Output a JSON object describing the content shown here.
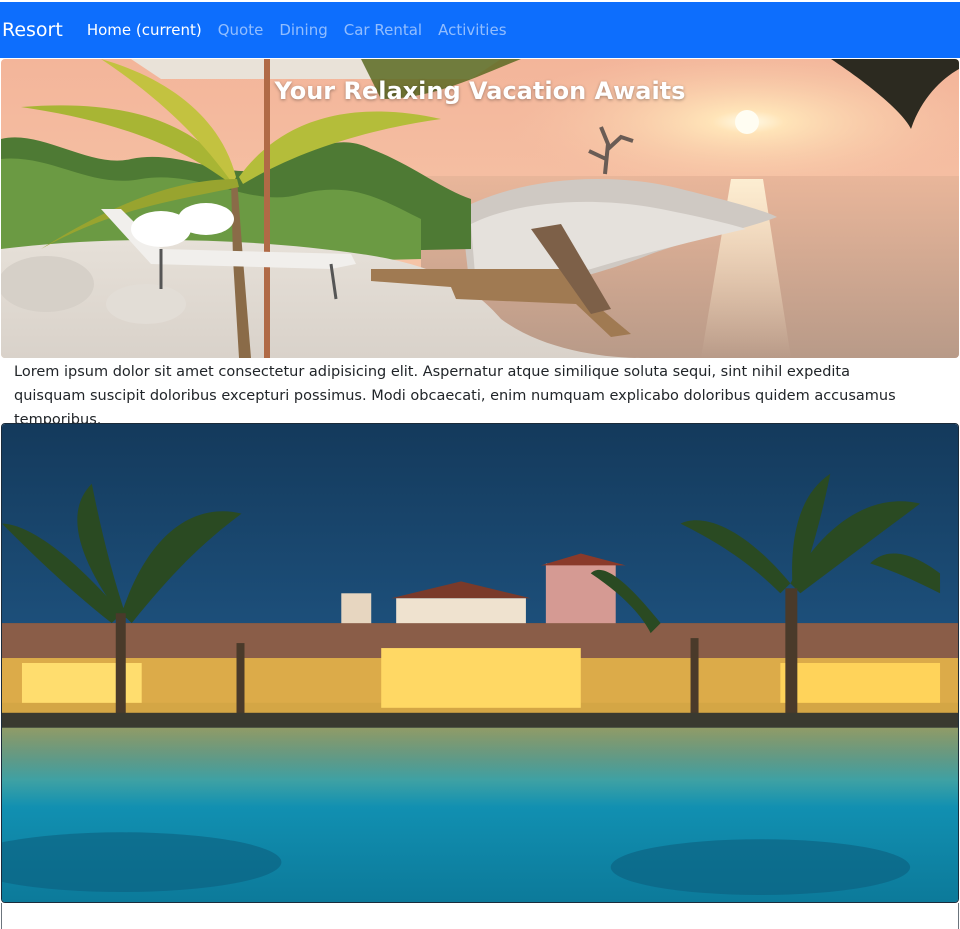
{
  "navbar": {
    "brand": "Resort",
    "links": [
      {
        "label": "Home (current)",
        "active": true
      },
      {
        "label": "Quote",
        "active": false
      },
      {
        "label": "Dining",
        "active": false
      },
      {
        "label": "Car Rental",
        "active": false
      },
      {
        "label": "Activities",
        "active": false
      }
    ],
    "color": "#0d6efd"
  },
  "hero": {
    "title": "Your Relaxing Vacation Awaits"
  },
  "intro": {
    "text": "Lorem ipsum dolor sit amet consectetur adipisicing elit. Aspernatur atque similique soluta sequi, sint nihil expedita quisquam suscipit doloribus excepturi possimus. Modi obcaecati, enim numquam explicabo doloribus quidem accusamus temporibus."
  }
}
